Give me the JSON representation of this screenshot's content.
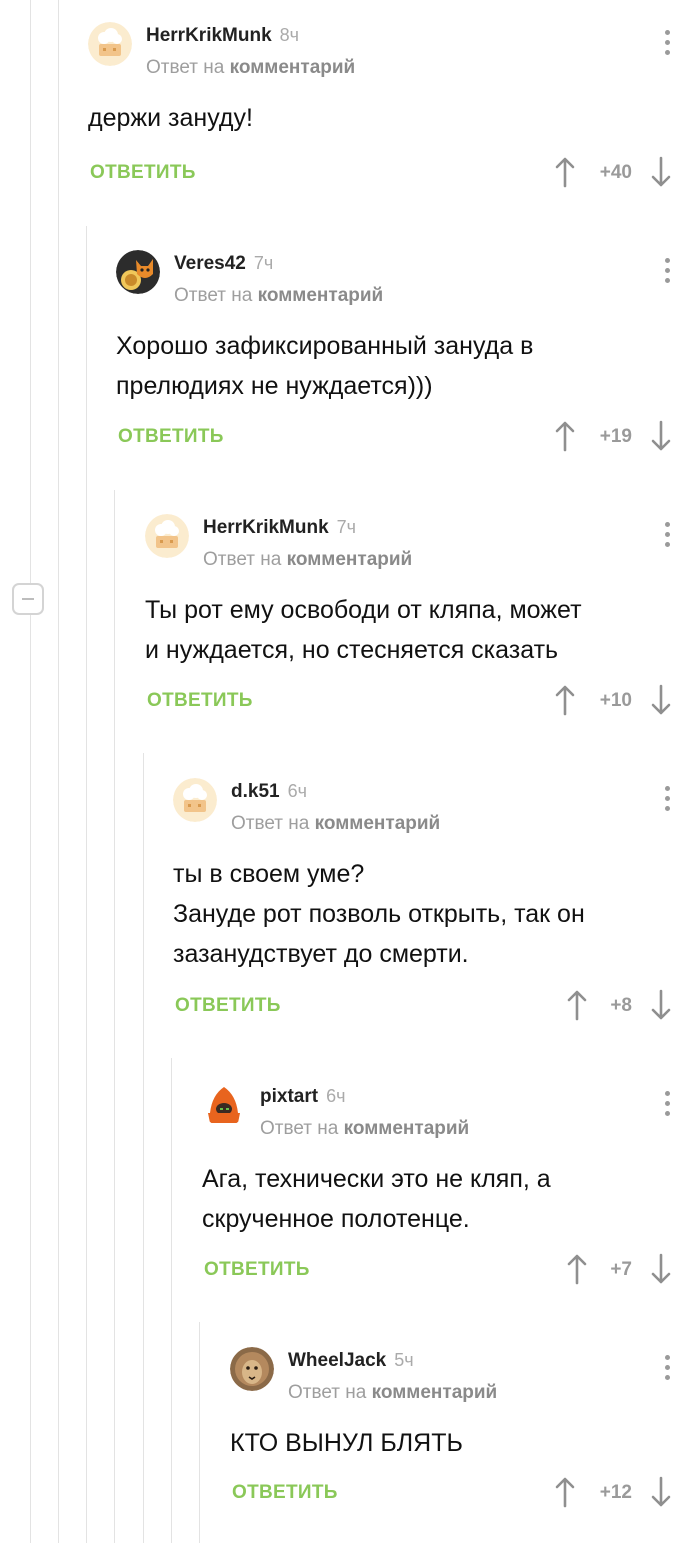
{
  "comments": [
    {
      "author": "HerrKrikMunk",
      "time": "8ч",
      "reply_prefix": "Ответ на",
      "reply_link": "комментарий",
      "text": [
        "держи зануду!"
      ],
      "reply_label": "ОТВЕТИТЬ",
      "score": "+40",
      "avatar": "chef-hat-avatar"
    },
    {
      "author": "Veres42",
      "time": "7ч",
      "reply_prefix": "Ответ на",
      "reply_link": "комментарий",
      "text": [
        "Хорошо зафиксированный зануда в",
        "прелюдиях не нуждается)))"
      ],
      "reply_label": "ОТВЕТИТЬ",
      "score": "+19",
      "avatar": "fox-avatar"
    },
    {
      "author": "HerrKrikMunk",
      "time": "7ч",
      "reply_prefix": "Ответ на",
      "reply_link": "комментарий",
      "text": [
        "Ты рот ему освободи от кляпа, может",
        "и нуждается, но стесняется сказать"
      ],
      "reply_label": "ОТВЕТИТЬ",
      "score": "+10",
      "avatar": "chef-hat-avatar"
    },
    {
      "author": "d.k51",
      "time": "6ч",
      "reply_prefix": "Ответ на",
      "reply_link": "комментарий",
      "text": [
        "ты в своем уме?",
        "Зануде рот позволь открыть, так он",
        "зазанудствует до смерти."
      ],
      "reply_label": "ОТВЕТИТЬ",
      "score": "+8",
      "avatar": "chef-hat-avatar"
    },
    {
      "author": "pixtart",
      "time": "6ч",
      "reply_prefix": "Ответ на",
      "reply_link": "комментарий",
      "text": [
        "Ага, технически это не кляп, а",
        "скрученное полотенце."
      ],
      "reply_label": "ОТВЕТИТЬ",
      "score": "+7",
      "avatar": "orange-hood-avatar"
    },
    {
      "author": "WheelJack",
      "time": "5ч",
      "reply_prefix": "Ответ на",
      "reply_link": "комментарий",
      "text": [
        "КТО ВЫНУЛ БЛЯТЬ"
      ],
      "reply_label": "ОТВЕТИТЬ",
      "score": "+12",
      "avatar": "lion-avatar"
    }
  ],
  "colors": {
    "reply_green": "#8ac858",
    "meta_gray": "#9e9e9e",
    "thread_line": "#e3e3e3"
  }
}
